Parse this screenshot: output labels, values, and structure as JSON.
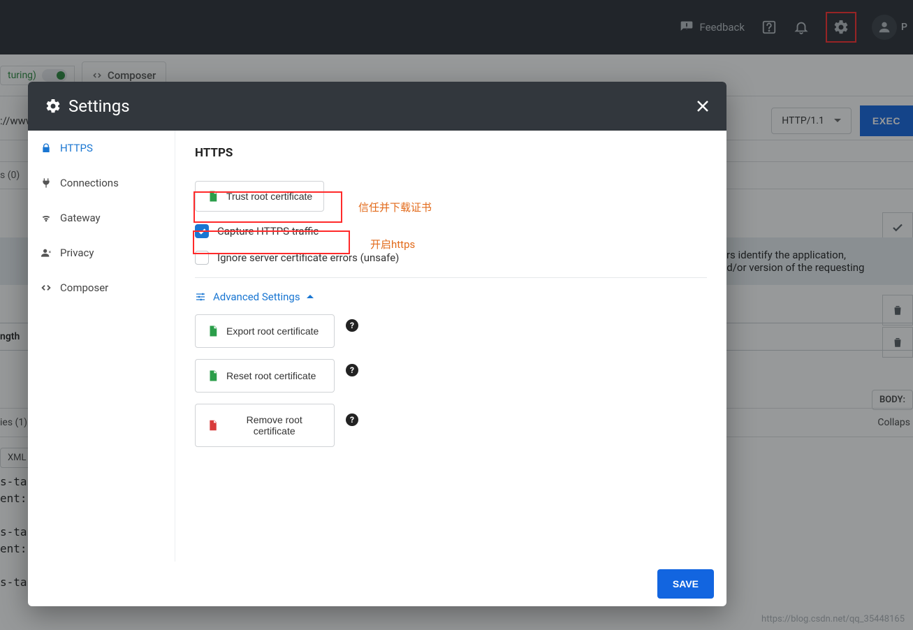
{
  "topbar": {
    "feedback": "Feedback",
    "user_initial": "P"
  },
  "subbar": {
    "capturing": "turing)",
    "composer": "Composer"
  },
  "urlrow": {
    "url_fragment": "://www",
    "http_version": "HTTP/1.1",
    "execute": "EXEC"
  },
  "section_label": "s (0)",
  "headers_text": "ers identify the application,\nnd/or version of the requesting",
  "ngth_label": "ngth",
  "body_label": "BODY:",
  "cookies": {
    "label": "ies (1)",
    "collapse": "Collaps"
  },
  "xml_label": "XML",
  "code_text": "s-tab\nent:\n\ns-tab\nent:\n\ns-tab-wenku:before {",
  "watermark": "https://blog.csdn.net/qq_35448165",
  "modal": {
    "title": "Settings",
    "sidebar": {
      "items": [
        {
          "label": "HTTPS",
          "icon": "lock",
          "active": true
        },
        {
          "label": "Connections",
          "icon": "plug",
          "active": false
        },
        {
          "label": "Gateway",
          "icon": "wifi",
          "active": false
        },
        {
          "label": "Privacy",
          "icon": "user",
          "active": false
        },
        {
          "label": "Composer",
          "icon": "code",
          "active": false
        }
      ]
    },
    "panel": {
      "title": "HTTPS",
      "trust_btn": "Trust root certificate",
      "capture_label": "Capture HTTPS traffic",
      "ignore_label": "Ignore server certificate errors (unsafe)",
      "advanced_label": "Advanced Settings",
      "export_btn": "Export root certificate",
      "reset_btn": "Reset root certificate",
      "remove_btn": "Remove root certificate"
    },
    "footer": {
      "save": "SAVE"
    }
  },
  "annotations": {
    "trust": "信任并下载证书",
    "enable": "开启https"
  }
}
